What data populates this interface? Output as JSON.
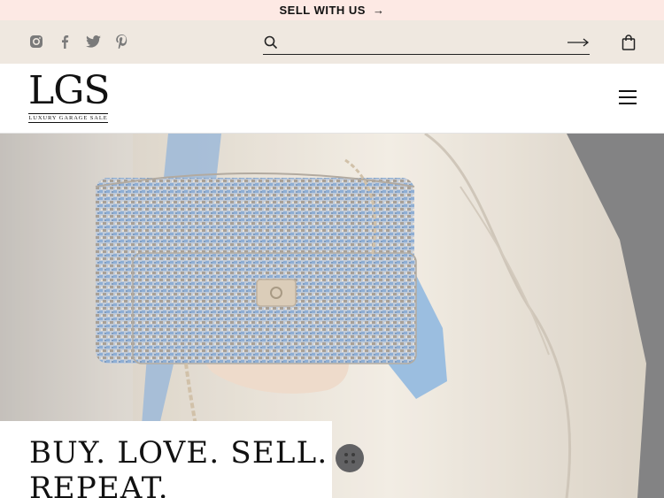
{
  "promo": {
    "label": "SELL WITH US",
    "arrow": "→"
  },
  "socials": [
    "instagram-icon",
    "facebook-icon",
    "twitter-icon",
    "pinterest-icon"
  ],
  "search": {
    "placeholder": "",
    "value": ""
  },
  "logo": {
    "mark": "LGS",
    "tagline": "LUXURY GARAGE SALE"
  },
  "hero": {
    "headline": "BUY. LOVE. SELL.\nREPEAT."
  },
  "colors": {
    "promo_bg": "#fde9e4",
    "utility_bg": "#efe8e0"
  }
}
